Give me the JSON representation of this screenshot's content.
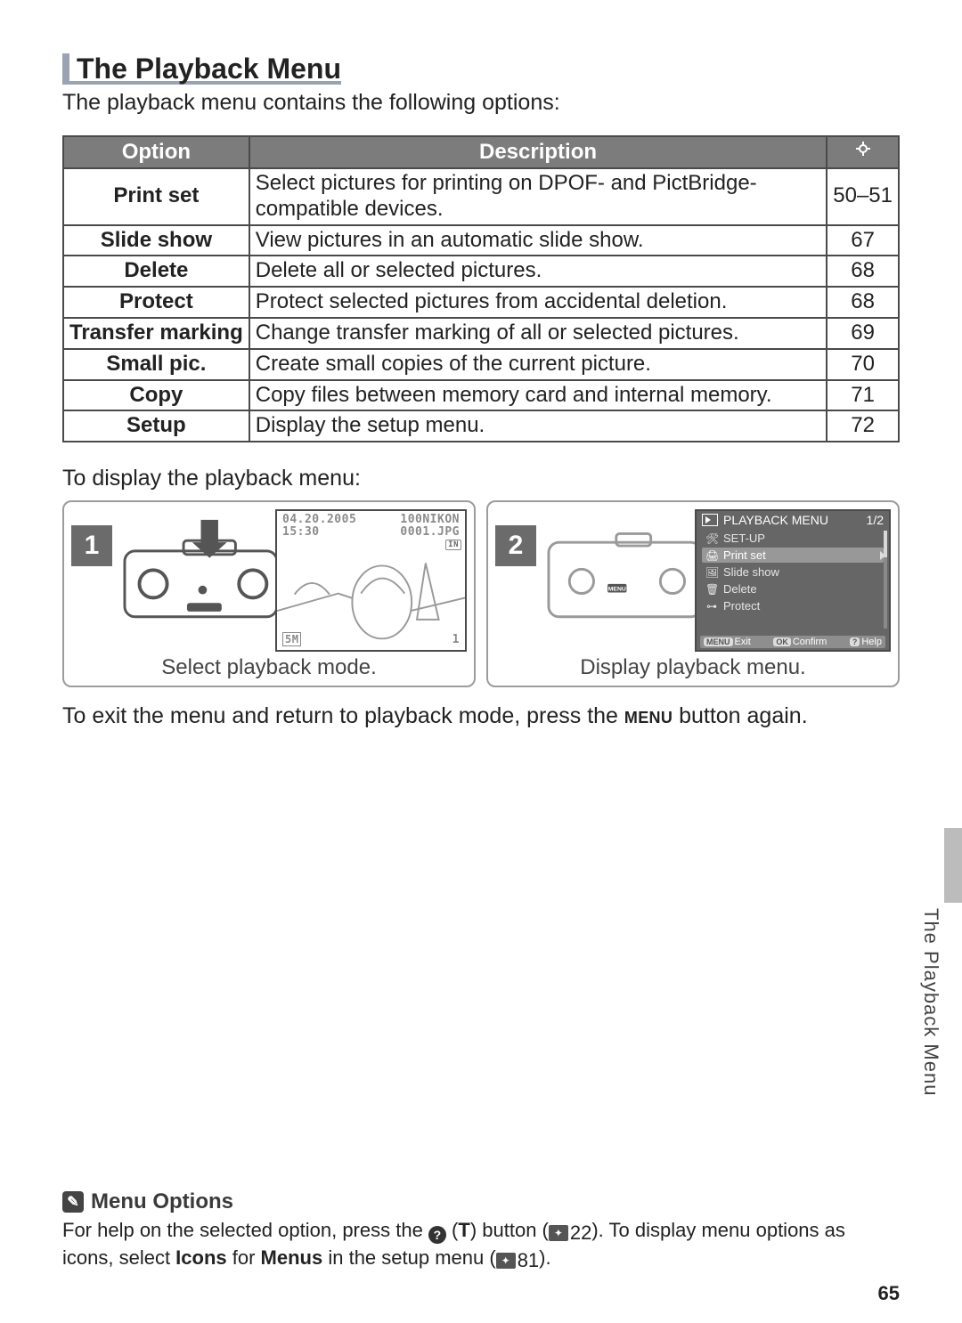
{
  "title": "The Playback Menu",
  "intro": "The playback menu contains the following options:",
  "table": {
    "headers": {
      "option": "Option",
      "description": "Description"
    },
    "rows": [
      {
        "option": "Print set",
        "description": "Select pictures for printing on DPOF- and PictBridge-compatible devices.",
        "page": "50–51"
      },
      {
        "option": "Slide show",
        "description": "View pictures in an automatic slide show.",
        "page": "67"
      },
      {
        "option": "Delete",
        "description": "Delete all or selected pictures.",
        "page": "68"
      },
      {
        "option": "Protect",
        "description": "Protect selected pictures from accidental deletion.",
        "page": "68"
      },
      {
        "option": "Transfer marking",
        "description": "Change transfer marking of all or selected pictures.",
        "page": "69"
      },
      {
        "option": "Small pic.",
        "description": "Create small copies of the current picture.",
        "page": "70"
      },
      {
        "option": "Copy",
        "description": "Copy files between memory card and internal memory.",
        "page": "71"
      },
      {
        "option": "Setup",
        "description": "Display the setup menu.",
        "page": "72"
      }
    ]
  },
  "subhead": "To display the playback menu:",
  "step1": {
    "num": "1",
    "caption": "Select playback mode.",
    "lcd": {
      "date": "04.20.2005",
      "time": "15:30",
      "folder": "100NIKON",
      "file": "0001.JPG",
      "in": "IN",
      "size": "5M",
      "count": "1"
    }
  },
  "step2": {
    "num": "2",
    "caption": "Display playback menu.",
    "menu": {
      "title": "PLAYBACK MENU",
      "page": "1/2",
      "items": [
        {
          "icon": "🛠",
          "label": "SET-UP"
        },
        {
          "icon": "🖨",
          "label": "Print set"
        },
        {
          "icon": "🖼",
          "label": "Slide show"
        },
        {
          "icon": "🗑",
          "label": "Delete"
        },
        {
          "icon": "⊶",
          "label": "Protect"
        }
      ],
      "selected_index": 1,
      "footer": {
        "exit": "Exit",
        "confirm": "Confirm",
        "help": "Help",
        "exit_chip": "MENU",
        "confirm_chip": "OK",
        "help_chip": "?"
      }
    }
  },
  "after_steps_pre": "To exit the menu and return to playback mode, press the ",
  "after_steps_btn": "MENU",
  "after_steps_post": " button again.",
  "side_label": "The Playback Menu",
  "footer_note": {
    "title": "Menu Options",
    "body_pre": "For help on the selected option, press the ",
    "help_btn": "?",
    "t_btn": "T",
    "body_mid1": " (",
    "body_mid2": ") button (",
    "ref1": "22",
    "body_mid3": ").  To display menu options as icons, select ",
    "icons_word": "Icons",
    "body_mid4": " for ",
    "menus_word": "Menus",
    "body_mid5": " in the setup menu (",
    "ref2": "81",
    "body_end": ")."
  },
  "page_number": "65"
}
